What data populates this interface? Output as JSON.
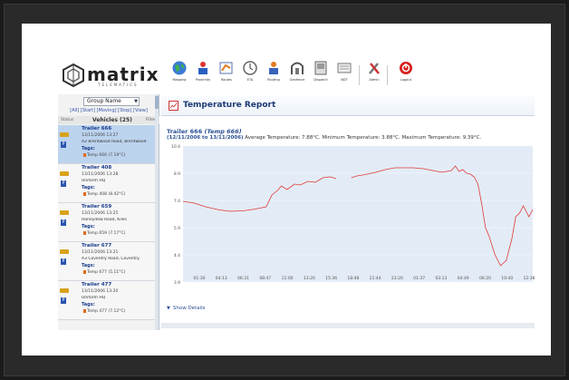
{
  "app": {
    "logo_text": "matrix",
    "logo_sub": "TELEMATICS"
  },
  "toolbar": [
    {
      "label": "Mapping",
      "icon": "globe-icon"
    },
    {
      "label": "Proximity",
      "icon": "proximity-icon"
    },
    {
      "label": "Routes",
      "icon": "routes-icon"
    },
    {
      "label": "ETA",
      "icon": "clock-icon"
    },
    {
      "label": "Routing",
      "icon": "routing-icon"
    },
    {
      "label": "Geofence",
      "icon": "geofence-icon"
    },
    {
      "label": "Dispatch",
      "icon": "dispatch-icon"
    },
    {
      "label": "NDT",
      "icon": "ndt-icon"
    },
    {
      "label": "Admin",
      "icon": "admin-icon"
    },
    {
      "label": "Logout",
      "icon": "logout-icon"
    }
  ],
  "sidebar": {
    "group_select": "Group Name",
    "filters": "[All] [Start] [Moving] [Stop] [View]",
    "header_left": "Status",
    "header_center": "Vehicles (25)",
    "header_right": "Filter",
    "items": [
      {
        "name": "Trailer 666",
        "time": "13/11/2006 13:27",
        "location": "A2 Brentwood Road, Brentwood",
        "tags": "Tags:",
        "temp": "Temp 666 (7.19°C)",
        "selected": true
      },
      {
        "name": "Trailer 408",
        "time": "13/11/2006 13:28",
        "location": "Uniform HQ",
        "tags": "Tags:",
        "temp": "Temp 408 (8.42°C)",
        "selected": false
      },
      {
        "name": "Trailer 659",
        "time": "13/11/2006 13:25",
        "location": "Honeydew Road, Kiles",
        "tags": "Tags:",
        "temp": "Temp 659 (7.17°C)",
        "selected": false
      },
      {
        "name": "Trailer 677",
        "time": "13/11/2006 13:21",
        "location": "A3 Coventry Road, Coventry",
        "tags": "Tags:",
        "temp": "Temp 677 (5.11°C)",
        "selected": false
      },
      {
        "name": "Trailer 477",
        "time": "13/11/2006 13:20",
        "location": "Uniform HQ",
        "tags": "Tags:",
        "temp": "Temp 477 (7.12°C)",
        "selected": false
      }
    ]
  },
  "main": {
    "report_title": "Temperature Report",
    "chart_heading": "Trailer 666",
    "chart_heading_italic": "(Temp 666)",
    "date_range": "(12/11/2006 to 13/11/2006)",
    "stats": "Average Temperature: 7.88°C.  Minimum Temperature: 3.88°C.  Maximum Temperature: 9.39°C.",
    "show_detail": "Show Details"
  },
  "chart_data": {
    "type": "line",
    "title": "",
    "xlabel": "",
    "ylabel": "",
    "ylim": [
      3,
      10.5
    ],
    "y_ticks": [
      "3.9",
      "4.4",
      "5.9",
      "7.4",
      "8.9",
      "10.4"
    ],
    "x_ticks": [
      "01:30",
      "04:13",
      "06:31",
      "08:47",
      "11:00",
      "13:20",
      "15:36",
      "18:48",
      "21:44",
      "23:20",
      "01:37",
      "03:13",
      "04:49",
      "06:20",
      "10:40",
      "12:38"
    ],
    "x_index_max": 18.5,
    "series": [
      {
        "color": "#e03a3a",
        "x": [
          0,
          0.6,
          1.2,
          1.9,
          2.5,
          3.2,
          3.8,
          4.4,
          4.7,
          5.0,
          5.2,
          5.5,
          5.9,
          6.2,
          6.6,
          7.0,
          7.4,
          7.8,
          8.1,
          8.4,
          8.9,
          9.2,
          9.5,
          10.2,
          10.7,
          11.2,
          11.7,
          12.2,
          12.7,
          13.2,
          13.7,
          14.2,
          14.4,
          14.6,
          14.8,
          15.0,
          15.2,
          15.4,
          15.6,
          15.8,
          16.0,
          16.2,
          16.5,
          16.8,
          17.1,
          17.4,
          17.6,
          17.8,
          18.0,
          18.3,
          18.5
        ],
        "y": [
          7.45,
          7.35,
          7.15,
          6.98,
          6.9,
          6.93,
          7.02,
          7.15,
          7.8,
          8.05,
          8.3,
          8.1,
          8.4,
          8.35,
          8.55,
          8.5,
          8.75,
          8.8,
          8.7,
          null,
          8.75,
          8.85,
          8.9,
          9.05,
          9.2,
          9.3,
          9.3,
          9.3,
          9.25,
          9.15,
          9.05,
          9.15,
          9.4,
          9.1,
          9.2,
          9.0,
          8.95,
          8.8,
          8.4,
          7.3,
          6.0,
          5.5,
          4.5,
          3.9,
          4.2,
          5.4,
          6.6,
          6.8,
          7.2,
          6.6,
          7.0
        ]
      }
    ]
  }
}
